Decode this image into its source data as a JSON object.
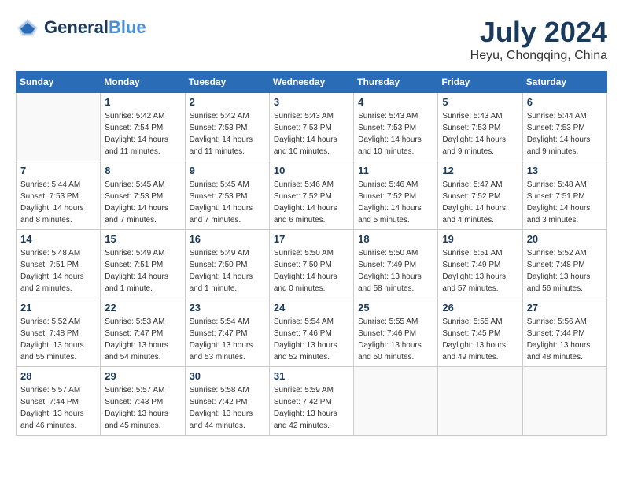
{
  "header": {
    "logo_line1": "General",
    "logo_line2": "Blue",
    "month_year": "July 2024",
    "location": "Heyu, Chongqing, China"
  },
  "columns": [
    "Sunday",
    "Monday",
    "Tuesday",
    "Wednesday",
    "Thursday",
    "Friday",
    "Saturday"
  ],
  "weeks": [
    [
      {
        "day": "",
        "sunrise": "",
        "sunset": "",
        "daylight": ""
      },
      {
        "day": "1",
        "sunrise": "Sunrise: 5:42 AM",
        "sunset": "Sunset: 7:54 PM",
        "daylight": "Daylight: 14 hours and 11 minutes."
      },
      {
        "day": "2",
        "sunrise": "Sunrise: 5:42 AM",
        "sunset": "Sunset: 7:53 PM",
        "daylight": "Daylight: 14 hours and 11 minutes."
      },
      {
        "day": "3",
        "sunrise": "Sunrise: 5:43 AM",
        "sunset": "Sunset: 7:53 PM",
        "daylight": "Daylight: 14 hours and 10 minutes."
      },
      {
        "day": "4",
        "sunrise": "Sunrise: 5:43 AM",
        "sunset": "Sunset: 7:53 PM",
        "daylight": "Daylight: 14 hours and 10 minutes."
      },
      {
        "day": "5",
        "sunrise": "Sunrise: 5:43 AM",
        "sunset": "Sunset: 7:53 PM",
        "daylight": "Daylight: 14 hours and 9 minutes."
      },
      {
        "day": "6",
        "sunrise": "Sunrise: 5:44 AM",
        "sunset": "Sunset: 7:53 PM",
        "daylight": "Daylight: 14 hours and 9 minutes."
      }
    ],
    [
      {
        "day": "7",
        "sunrise": "Sunrise: 5:44 AM",
        "sunset": "Sunset: 7:53 PM",
        "daylight": "Daylight: 14 hours and 8 minutes."
      },
      {
        "day": "8",
        "sunrise": "Sunrise: 5:45 AM",
        "sunset": "Sunset: 7:53 PM",
        "daylight": "Daylight: 14 hours and 7 minutes."
      },
      {
        "day": "9",
        "sunrise": "Sunrise: 5:45 AM",
        "sunset": "Sunset: 7:53 PM",
        "daylight": "Daylight: 14 hours and 7 minutes."
      },
      {
        "day": "10",
        "sunrise": "Sunrise: 5:46 AM",
        "sunset": "Sunset: 7:52 PM",
        "daylight": "Daylight: 14 hours and 6 minutes."
      },
      {
        "day": "11",
        "sunrise": "Sunrise: 5:46 AM",
        "sunset": "Sunset: 7:52 PM",
        "daylight": "Daylight: 14 hours and 5 minutes."
      },
      {
        "day": "12",
        "sunrise": "Sunrise: 5:47 AM",
        "sunset": "Sunset: 7:52 PM",
        "daylight": "Daylight: 14 hours and 4 minutes."
      },
      {
        "day": "13",
        "sunrise": "Sunrise: 5:48 AM",
        "sunset": "Sunset: 7:51 PM",
        "daylight": "Daylight: 14 hours and 3 minutes."
      }
    ],
    [
      {
        "day": "14",
        "sunrise": "Sunrise: 5:48 AM",
        "sunset": "Sunset: 7:51 PM",
        "daylight": "Daylight: 14 hours and 2 minutes."
      },
      {
        "day": "15",
        "sunrise": "Sunrise: 5:49 AM",
        "sunset": "Sunset: 7:51 PM",
        "daylight": "Daylight: 14 hours and 1 minute."
      },
      {
        "day": "16",
        "sunrise": "Sunrise: 5:49 AM",
        "sunset": "Sunset: 7:50 PM",
        "daylight": "Daylight: 14 hours and 1 minute."
      },
      {
        "day": "17",
        "sunrise": "Sunrise: 5:50 AM",
        "sunset": "Sunset: 7:50 PM",
        "daylight": "Daylight: 14 hours and 0 minutes."
      },
      {
        "day": "18",
        "sunrise": "Sunrise: 5:50 AM",
        "sunset": "Sunset: 7:49 PM",
        "daylight": "Daylight: 13 hours and 58 minutes."
      },
      {
        "day": "19",
        "sunrise": "Sunrise: 5:51 AM",
        "sunset": "Sunset: 7:49 PM",
        "daylight": "Daylight: 13 hours and 57 minutes."
      },
      {
        "day": "20",
        "sunrise": "Sunrise: 5:52 AM",
        "sunset": "Sunset: 7:48 PM",
        "daylight": "Daylight: 13 hours and 56 minutes."
      }
    ],
    [
      {
        "day": "21",
        "sunrise": "Sunrise: 5:52 AM",
        "sunset": "Sunset: 7:48 PM",
        "daylight": "Daylight: 13 hours and 55 minutes."
      },
      {
        "day": "22",
        "sunrise": "Sunrise: 5:53 AM",
        "sunset": "Sunset: 7:47 PM",
        "daylight": "Daylight: 13 hours and 54 minutes."
      },
      {
        "day": "23",
        "sunrise": "Sunrise: 5:54 AM",
        "sunset": "Sunset: 7:47 PM",
        "daylight": "Daylight: 13 hours and 53 minutes."
      },
      {
        "day": "24",
        "sunrise": "Sunrise: 5:54 AM",
        "sunset": "Sunset: 7:46 PM",
        "daylight": "Daylight: 13 hours and 52 minutes."
      },
      {
        "day": "25",
        "sunrise": "Sunrise: 5:55 AM",
        "sunset": "Sunset: 7:46 PM",
        "daylight": "Daylight: 13 hours and 50 minutes."
      },
      {
        "day": "26",
        "sunrise": "Sunrise: 5:55 AM",
        "sunset": "Sunset: 7:45 PM",
        "daylight": "Daylight: 13 hours and 49 minutes."
      },
      {
        "day": "27",
        "sunrise": "Sunrise: 5:56 AM",
        "sunset": "Sunset: 7:44 PM",
        "daylight": "Daylight: 13 hours and 48 minutes."
      }
    ],
    [
      {
        "day": "28",
        "sunrise": "Sunrise: 5:57 AM",
        "sunset": "Sunset: 7:44 PM",
        "daylight": "Daylight: 13 hours and 46 minutes."
      },
      {
        "day": "29",
        "sunrise": "Sunrise: 5:57 AM",
        "sunset": "Sunset: 7:43 PM",
        "daylight": "Daylight: 13 hours and 45 minutes."
      },
      {
        "day": "30",
        "sunrise": "Sunrise: 5:58 AM",
        "sunset": "Sunset: 7:42 PM",
        "daylight": "Daylight: 13 hours and 44 minutes."
      },
      {
        "day": "31",
        "sunrise": "Sunrise: 5:59 AM",
        "sunset": "Sunset: 7:42 PM",
        "daylight": "Daylight: 13 hours and 42 minutes."
      },
      {
        "day": "",
        "sunrise": "",
        "sunset": "",
        "daylight": ""
      },
      {
        "day": "",
        "sunrise": "",
        "sunset": "",
        "daylight": ""
      },
      {
        "day": "",
        "sunrise": "",
        "sunset": "",
        "daylight": ""
      }
    ]
  ]
}
